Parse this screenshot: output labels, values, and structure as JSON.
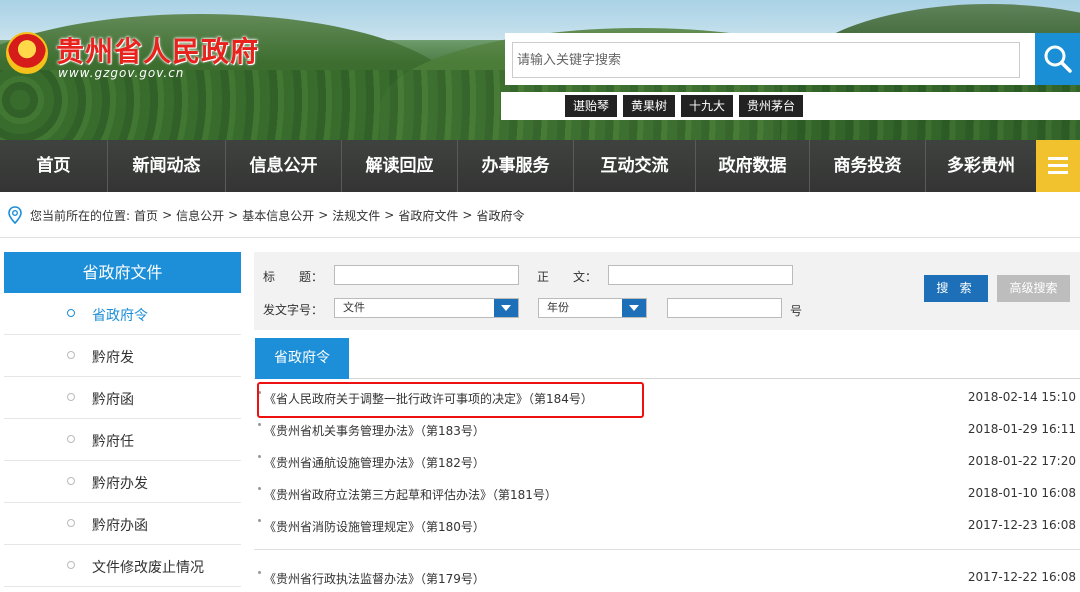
{
  "header": {
    "site_title": "贵州省人民政府",
    "site_url": "www.gzgov.gov.cn",
    "search_placeholder": "请输入关键字搜索",
    "hot_tags": [
      "谌贻琴",
      "黄果树",
      "十九大",
      "贵州茅台"
    ]
  },
  "nav": {
    "items": [
      "首页",
      "新闻动态",
      "信息公开",
      "解读回应",
      "办事服务",
      "互动交流",
      "政府数据",
      "商务投资",
      "多彩贵州"
    ]
  },
  "breadcrumb": {
    "prefix": "您当前所在的位置:",
    "items": [
      "首页",
      "信息公开",
      "基本信息公开",
      "法规文件",
      "省政府文件",
      "省政府令"
    ],
    "separator": ">"
  },
  "sidebar": {
    "title": "省政府文件",
    "items": [
      {
        "label": "省政府令",
        "active": true
      },
      {
        "label": "黔府发",
        "active": false
      },
      {
        "label": "黔府函",
        "active": false
      },
      {
        "label": "黔府任",
        "active": false
      },
      {
        "label": "黔府办发",
        "active": false
      },
      {
        "label": "黔府办函",
        "active": false
      },
      {
        "label": "文件修改废止情况",
        "active": false
      }
    ]
  },
  "filter": {
    "title_label": "标　　题：",
    "body_label": "正　　文：",
    "doc_no_label": "发文字号：",
    "doc_type_value": "文件",
    "year_value": "年份",
    "number_suffix": "号",
    "search_button": "搜 索",
    "advanced_button": "高级搜索"
  },
  "content": {
    "tab_label": "省政府令",
    "docs": [
      {
        "title": "《省人民政府关于调整一批行政许可事项的决定》（第184号）",
        "date": "2018-02-14 15:10",
        "highlighted": true
      },
      {
        "title": "《贵州省机关事务管理办法》（第183号）",
        "date": "2018-01-29 16:11",
        "highlighted": false
      },
      {
        "title": "《贵州省通航设施管理办法》（第182号）",
        "date": "2018-01-22 17:20",
        "highlighted": false
      },
      {
        "title": "《贵州省政府立法第三方起草和评估办法》（第181号）",
        "date": "2018-01-10 16:08",
        "highlighted": false
      },
      {
        "title": "《贵州省消防设施管理规定》（第180号）",
        "date": "2017-12-23 16:08",
        "highlighted": false
      },
      {
        "title": "《贵州省行政执法监督办法》（第179号）",
        "date": "2017-12-22 16:08",
        "highlighted": false
      }
    ]
  },
  "colors": {
    "primary_blue": "#1d8fd8",
    "dark_blue": "#1d6fb8",
    "title_red": "#e8221c",
    "menu_yellow": "#f2c12e",
    "highlight_red": "#e11111"
  }
}
